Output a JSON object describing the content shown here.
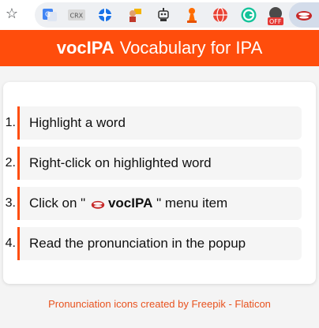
{
  "header": {
    "brand": "vocIPA",
    "tagline": "Vocabulary for IPA"
  },
  "steps": [
    {
      "num": "1.",
      "text": "Highlight a word"
    },
    {
      "num": "2.",
      "text": "Right-click on highlighted word"
    },
    {
      "num": "3.",
      "prefix": "Click on \"",
      "menu_item": "vocIPA",
      "suffix": "\" menu item"
    },
    {
      "num": "4.",
      "text": "Read the pronunciation in the popup"
    }
  ],
  "footer": {
    "text": "Pronunciation icons created by Freepik - Flaticon"
  },
  "toolbar": {
    "crx_label": "CRX",
    "extensions": [
      "translate-icon",
      "crx-icon",
      "blue-cross-icon",
      "person-sign-icon",
      "robot-icon",
      "chess-pawn-icon",
      "globe-icon",
      "grammarly-icon",
      "off-badge-icon",
      "vocipa-lips-icon"
    ],
    "off_badge": "OFF"
  },
  "colors": {
    "accent": "#ff4d0c",
    "footer_text": "#e8521e"
  }
}
